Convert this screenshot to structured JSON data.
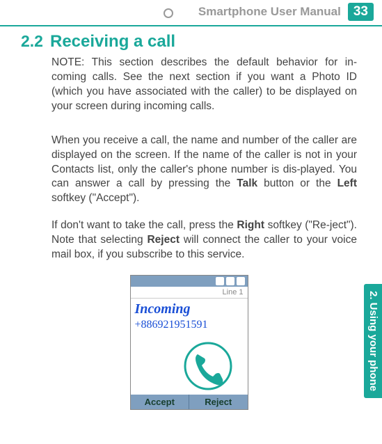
{
  "header": {
    "manual_title": "Smartphone User Manual",
    "page_number": "33"
  },
  "side_tab": "2. Using your phone",
  "section": {
    "number": "2.2",
    "title": "Receiving a call"
  },
  "paragraphs": {
    "p1_a": "NOTE:  This section describes the default behavior for in-coming calls.  See the next section if you want a Photo ID (which you have associated with the caller) to be displayed on your screen during incoming calls.",
    "p2_a": "When you receive a call, the name and number of the caller are displayed on the screen.  If the name of the caller is not in your Contacts list, only the caller's phone number is dis-played.  You can answer a call by pressing the ",
    "p2_b": "Talk",
    "p2_c": " button or the ",
    "p2_d": "Left",
    "p2_e": " softkey (\"Accept\").",
    "p3_a": "If don't want to take the call, press the ",
    "p3_b": "Right",
    "p3_c": " softkey (\"Re-ject\").  Note that selecting ",
    "p3_d": "Reject",
    "p3_e": " will connect the caller to your voice mail box, if you subscribe to this service."
  },
  "phone": {
    "line_label": "Line 1",
    "incoming_label": "Incoming",
    "number": "+886921951591",
    "soft_left": "Accept",
    "soft_right": "Reject"
  }
}
